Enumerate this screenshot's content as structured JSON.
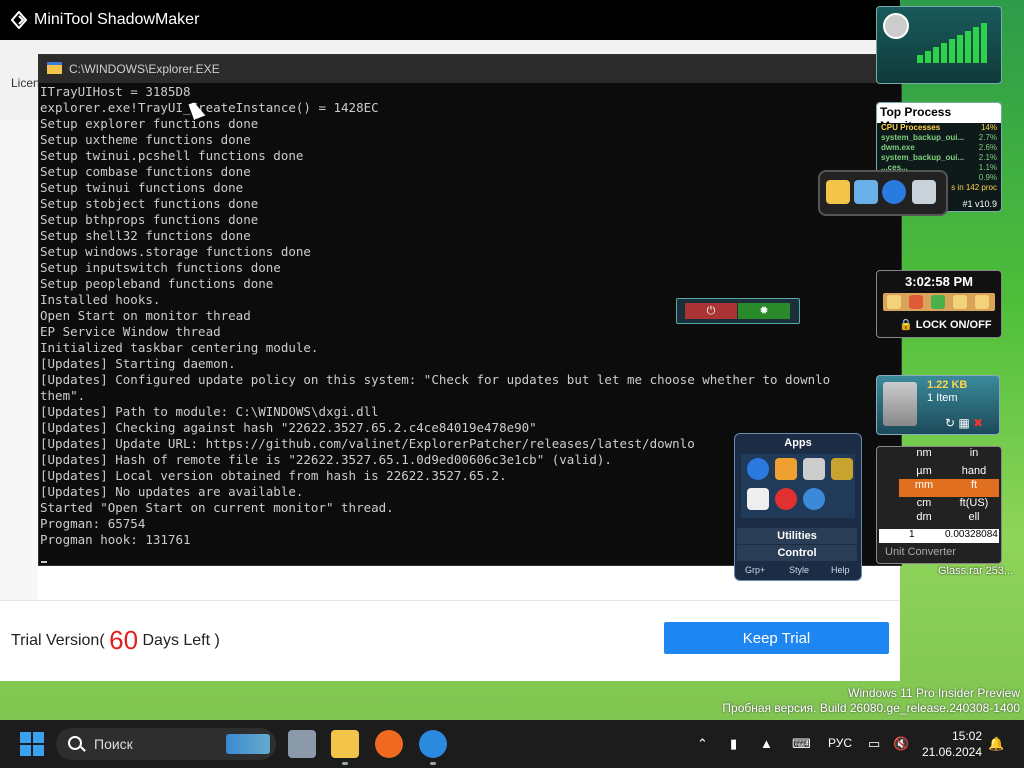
{
  "app": {
    "title": "MiniTool ShadowMaker",
    "license_label": "Licen"
  },
  "trial": {
    "prefix": "Trial Version(",
    "days": "60",
    "suffix": "Days Left )",
    "keep_button": "Keep Trial"
  },
  "console": {
    "title": "C:\\WINDOWS\\Explorer.EXE",
    "lines": [
      "ITrayUIHost = 3185D8",
      "explorer.exe!TrayUI_CreateInstance() = 1428EC",
      "Setup explorer functions done",
      "Setup uxtheme functions done",
      "Setup twinui.pcshell functions done",
      "Setup combase functions done",
      "Setup twinui functions done",
      "Setup stobject functions done",
      "Setup bthprops functions done",
      "Setup shell32 functions done",
      "Setup windows.storage functions done",
      "Setup inputswitch functions done",
      "Setup peopleband functions done",
      "Installed hooks.",
      "Open Start on monitor thread",
      "EP Service Window thread",
      "Initialized taskbar centering module.",
      "[Updates] Starting daemon.",
      "[Updates] Configured update policy on this system: \"Check for updates but let me choose whether to downlo",
      "them\".",
      "[Updates] Path to module: C:\\WINDOWS\\dxgi.dll",
      "[Updates] Checking against hash \"22622.3527.65.2.c4ce84019e478e90\"",
      "[Updates] Update URL: https://github.com/valinet/ExplorerPatcher/releases/latest/downlo",
      "[Updates] Hash of remote file is \"22622.3527.65.1.0d9ed00606c3e1cb\" (valid).",
      "[Updates] Local version obtained from hash is 22622.3527.65.2.",
      "[Updates] No updates are available.",
      "Started \"Open Start on current monitor\" thread.",
      "Progman: 65754",
      "Progman hook: 131761"
    ]
  },
  "gadgets": {
    "top_process": {
      "title": "Top Process Monitor",
      "rows": [
        {
          "name": "CPU Processes",
          "value": "14%"
        },
        {
          "name": "system_backup_oui...",
          "value": "2.7%"
        },
        {
          "name": "dwm.exe",
          "value": "2.6%"
        },
        {
          "name": "system_backup_oui...",
          "value": "2.1%"
        },
        {
          "name": "...ces...",
          "value": "1.1%"
        },
        {
          "name": "",
          "value": "0.9%"
        }
      ],
      "footer": "s in 142 proc",
      "footer2": "#1 v10.9"
    },
    "clock": {
      "time": "3:02:58 PM",
      "lock": "LOCK ON/OFF"
    },
    "recycle": {
      "size": "1.22 KB",
      "items": "1 Item"
    },
    "converter": {
      "rows": [
        {
          "a": "nm",
          "b": "in"
        },
        {
          "a": "µm",
          "b": "hand"
        },
        {
          "a": "mm",
          "b": "ft"
        },
        {
          "a": "cm",
          "b": "ft(US)"
        },
        {
          "a": "dm",
          "b": "ell"
        }
      ],
      "input": "1",
      "output": "0.00328084",
      "label": "Unit Converter"
    },
    "glass_label": "Glass.rar 253...",
    "launcher": {
      "header": "Apps",
      "utilities": "Utilities",
      "control": "Control",
      "foot": [
        "Grp+",
        "Style",
        "Help"
      ]
    }
  },
  "watermark": {
    "line1": "Windows 11 Pro Insider Preview",
    "line2": "Пробная версия. Build 26080.ge_release.240308-1400"
  },
  "taskbar": {
    "search_placeholder": "Поиск",
    "lang": "РУС",
    "time": "15:02",
    "date": "21.06.2024"
  }
}
